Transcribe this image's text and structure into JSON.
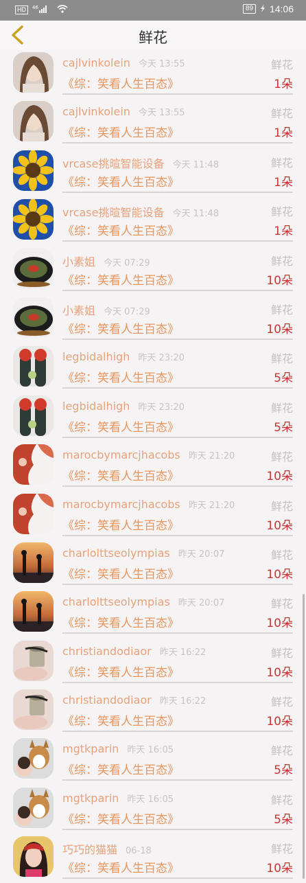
{
  "status_bar": {
    "network": "HD",
    "signal": "⁴⁶",
    "battery": "89",
    "time": "14:06"
  },
  "header": {
    "title": "鲜花"
  },
  "rows": [
    {
      "name": "cajlvinkolein",
      "time": "今天 13:55",
      "gift": "鲜花",
      "program": "《综：笑看人生百态》",
      "count": "1朵",
      "avatar": "woman"
    },
    {
      "name": "cajlvinkolein",
      "time": "今天 13:55",
      "gift": "鲜花",
      "program": "《综：笑看人生百态》",
      "count": "1朵",
      "avatar": "woman"
    },
    {
      "name": "vrcase挑暄智能设备",
      "time": "今天 11:48",
      "gift": "鲜花",
      "program": "《综：笑看人生百态》",
      "count": "1朵",
      "avatar": "sunflower"
    },
    {
      "name": "vrcase挑暄智能设备",
      "time": "今天 11:48",
      "gift": "鲜花",
      "program": "《综：笑看人生百态》",
      "count": "1朵",
      "avatar": "sunflower"
    },
    {
      "name": "小素姐",
      "time": "今天 07:29",
      "gift": "鲜花",
      "program": "《综：笑看人生百态》",
      "count": "10朵",
      "avatar": "dish"
    },
    {
      "name": "小素姐",
      "time": "今天 07:29",
      "gift": "鲜花",
      "program": "《综：笑看人生百态》",
      "count": "10朵",
      "avatar": "dish"
    },
    {
      "name": "legbidalhigh",
      "time": "昨天 23:20",
      "gift": "鲜花",
      "program": "《综：笑看人生百态》",
      "count": "5朵",
      "avatar": "cactus"
    },
    {
      "name": "legbidalhigh",
      "time": "昨天 23:20",
      "gift": "鲜花",
      "program": "《综：笑看人生百态》",
      "count": "5朵",
      "avatar": "cactus"
    },
    {
      "name": "marocbymarcjhacobs",
      "time": "昨天 21:20",
      "gift": "鲜花",
      "program": "《综：笑看人生百态》",
      "count": "10朵",
      "avatar": "red"
    },
    {
      "name": "marocbymarcjhacobs",
      "time": "昨天 21:20",
      "gift": "鲜花",
      "program": "《综：笑看人生百态》",
      "count": "10朵",
      "avatar": "red"
    },
    {
      "name": "charlolttseolympias",
      "time": "昨天 20:07",
      "gift": "鲜花",
      "program": "《综：笑看人生百态》",
      "count": "10朵",
      "avatar": "sunset"
    },
    {
      "name": "charlolttseolympias",
      "time": "昨天 20:07",
      "gift": "鲜花",
      "program": "《综：笑看人生百态》",
      "count": "10朵",
      "avatar": "sunset"
    },
    {
      "name": "christiandodiaor",
      "time": "昨天 16:22",
      "gift": "鲜花",
      "program": "《综：笑看人生百态》",
      "count": "10朵",
      "avatar": "cup"
    },
    {
      "name": "christiandodiaor",
      "time": "昨天 16:22",
      "gift": "鲜花",
      "program": "《综：笑看人生百态》",
      "count": "10朵",
      "avatar": "cup"
    },
    {
      "name": "mgtkparin",
      "time": "昨天 16:05",
      "gift": "鲜花",
      "program": "《综：笑看人生百态》",
      "count": "5朵",
      "avatar": "dog"
    },
    {
      "name": "mgtkparin",
      "time": "昨天 16:05",
      "gift": "鲜花",
      "program": "《综：笑看人生百态》",
      "count": "5朵",
      "avatar": "dog"
    },
    {
      "name": "巧巧的猫猫",
      "time": "06-18",
      "gift": "鲜花",
      "program": "《综：笑看人生百态》",
      "count": "10朵",
      "avatar": "girl"
    }
  ]
}
